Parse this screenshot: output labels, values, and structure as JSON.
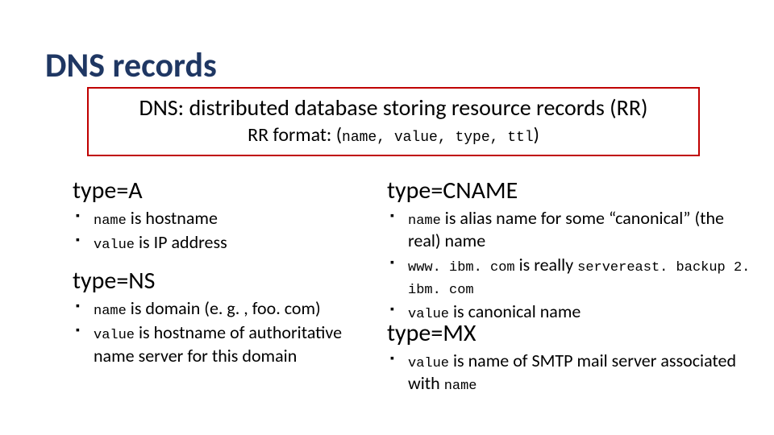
{
  "title": "DNS records",
  "defbox": {
    "line1": "DNS: distributed database storing resource records (RR)",
    "line2_prefix": "RR format: ",
    "tuple": "name, value, type, ttl",
    "open_paren": "(",
    "close_paren": ")"
  },
  "typeA": {
    "heading": "type=A",
    "b1": {
      "pre": "name",
      "post": " is hostname"
    },
    "b2": {
      "pre": "value",
      "post": " is IP address"
    }
  },
  "typeNS": {
    "heading": "type=NS",
    "b1": {
      "pre": "name",
      "post": " is domain (e. g. , foo. com)"
    },
    "b2": {
      "pre": "value",
      "post": " is hostname of authoritative name server for this domain"
    }
  },
  "typeCNAME": {
    "heading": "type=CNAME",
    "b1": {
      "pre": "name",
      "post": " is alias name for some “canonical” (the real) name"
    },
    "b2": {
      "pre": "www. ibm. com",
      "mid": " is really ",
      "post": "servereast. backup 2. ibm. com"
    },
    "b3": {
      "pre": "value",
      "post": " is canonical name"
    }
  },
  "typeMX": {
    "heading": "type=MX",
    "b1": {
      "pre": "value",
      "mid": " is name of SMTP mail server associated with ",
      "post": "name"
    }
  }
}
